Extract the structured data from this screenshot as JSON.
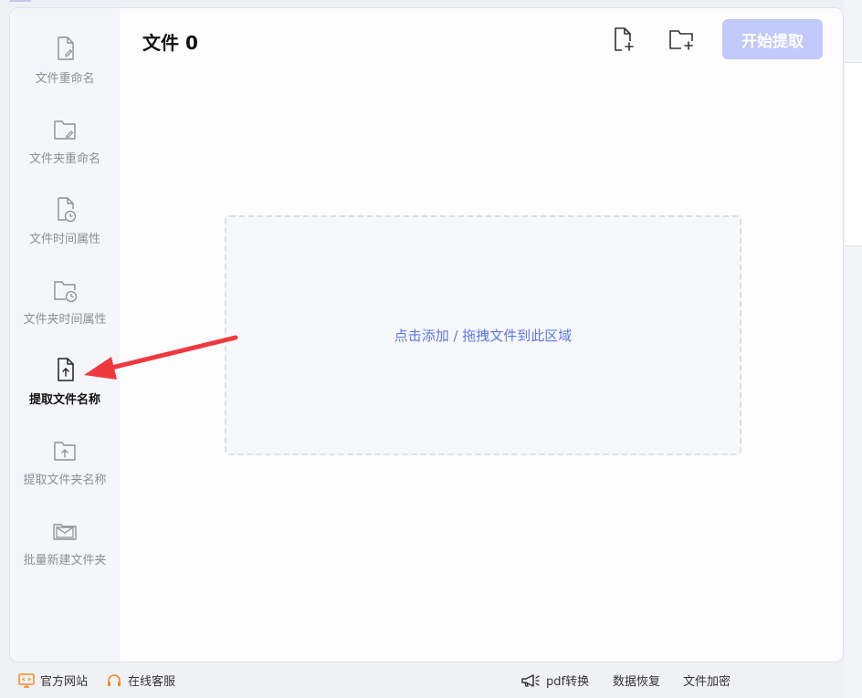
{
  "sidebar": {
    "items": [
      {
        "label": "文件重命名",
        "icon": "file-edit-icon"
      },
      {
        "label": "文件夹重命名",
        "icon": "folder-edit-icon"
      },
      {
        "label": "文件时间属性",
        "icon": "file-clock-icon"
      },
      {
        "label": "文件夹时间属性",
        "icon": "folder-clock-icon"
      },
      {
        "label": "提取文件名称",
        "icon": "file-upload-icon",
        "active": true
      },
      {
        "label": "提取文件夹名称",
        "icon": "folder-upload-icon"
      },
      {
        "label": "批量新建文件夹",
        "icon": "folders-mail-icon"
      }
    ]
  },
  "header": {
    "title": "文件 0",
    "add_file_icon": "file-plus-icon",
    "add_folder_icon": "folder-plus-icon",
    "start_label": "开始提取"
  },
  "dropzone": {
    "text": "点击添加 / 拖拽文件到此区域"
  },
  "footer": {
    "official_site": "官方网站",
    "online_service": "在线客服",
    "pdf": "pdf转换",
    "data_recovery": "数据恢复",
    "file_encrypt": "文件加密"
  },
  "colors": {
    "accent": "#5b78e6",
    "button_disabled": "#c2c9fb",
    "arrow": "#f0393f",
    "footer_orange": "#f08a24"
  }
}
